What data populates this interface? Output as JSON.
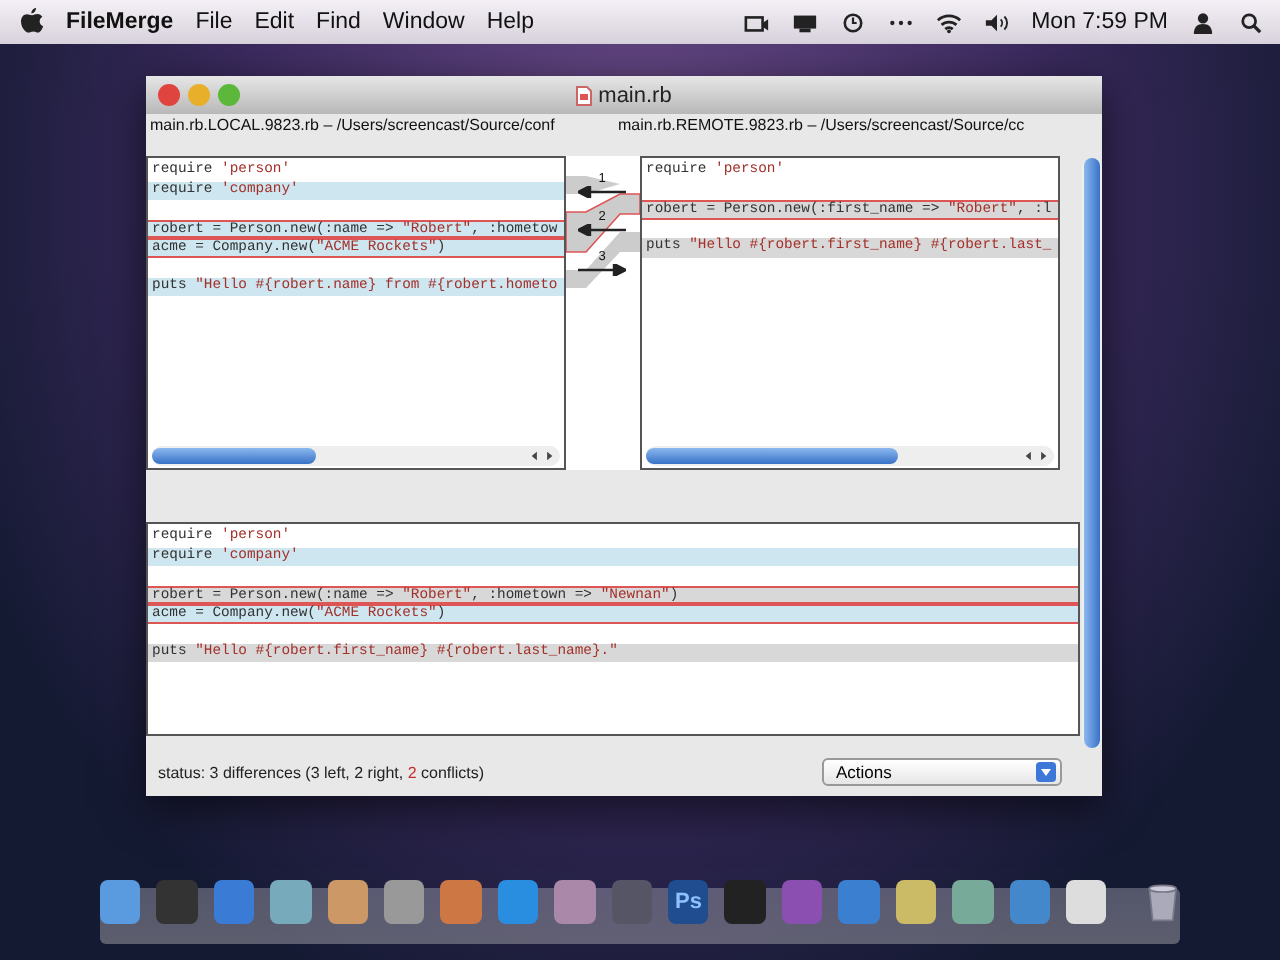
{
  "menu_bar": {
    "app_name": "FileMerge",
    "menus": [
      "File",
      "Edit",
      "Find",
      "Window",
      "Help"
    ],
    "clock": "Mon 7:59 PM"
  },
  "window": {
    "title": "main.rb",
    "left_file": "main.rb.LOCAL.9823.rb – /Users/screencast/Source/conf",
    "right_file": "main.rb.REMOTE.9823.rb – /Users/screencast/Source/cc",
    "left_lines": [
      {
        "kind": "plain",
        "conflict": false,
        "segments": [
          {
            "text": "require ",
            "kind": "code"
          },
          {
            "text": "'person'",
            "kind": "string"
          }
        ]
      },
      {
        "kind": "left",
        "conflict": false,
        "segments": [
          {
            "text": "require ",
            "kind": "code"
          },
          {
            "text": "'company'",
            "kind": "string"
          }
        ]
      },
      {
        "kind": "blank"
      },
      {
        "kind": "left",
        "conflict": true,
        "segments": [
          {
            "text": "robert = Person.new(:name => ",
            "kind": "code"
          },
          {
            "text": "\"Robert\"",
            "kind": "string"
          },
          {
            "text": ", :hometow",
            "kind": "code"
          }
        ]
      },
      {
        "kind": "left",
        "conflict": true,
        "segments": [
          {
            "text": "acme = Company.new(",
            "kind": "code"
          },
          {
            "text": "\"ACME Rockets\"",
            "kind": "string"
          },
          {
            "text": ")",
            "kind": "code"
          }
        ]
      },
      {
        "kind": "blank"
      },
      {
        "kind": "left",
        "conflict": false,
        "segments": [
          {
            "text": "puts ",
            "kind": "code"
          },
          {
            "text": "\"Hello #{robert.name} from #{robert.hometo",
            "kind": "string"
          }
        ]
      }
    ],
    "right_lines": [
      {
        "kind": "plain",
        "conflict": false,
        "segments": [
          {
            "text": "require ",
            "kind": "code"
          },
          {
            "text": "'person'",
            "kind": "string"
          }
        ]
      },
      {
        "kind": "blank"
      },
      {
        "kind": "right",
        "conflict": true,
        "segments": [
          {
            "text": "robert = Person.new(:first_name => ",
            "kind": "code"
          },
          {
            "text": "\"Robert\"",
            "kind": "string"
          },
          {
            "text": ", :l",
            "kind": "code"
          }
        ]
      },
      {
        "kind": "blank"
      },
      {
        "kind": "right",
        "conflict": false,
        "segments": [
          {
            "text": "puts ",
            "kind": "code"
          },
          {
            "text": "\"Hello #{robert.first_name} #{robert.last_",
            "kind": "string"
          }
        ]
      }
    ],
    "differences": [
      {
        "label": "1",
        "kind": "left"
      },
      {
        "label": "2",
        "kind": "left"
      },
      {
        "label": "3",
        "kind": "right"
      }
    ],
    "merged_lines": [
      {
        "kind": "plain",
        "conflict": false,
        "segments": [
          {
            "text": "require ",
            "kind": "code"
          },
          {
            "text": "'person'",
            "kind": "string"
          }
        ]
      },
      {
        "kind": "left",
        "conflict": false,
        "segments": [
          {
            "text": "require ",
            "kind": "code"
          },
          {
            "text": "'company'",
            "kind": "string"
          }
        ]
      },
      {
        "kind": "blank"
      },
      {
        "kind": "right",
        "conflict": true,
        "segments": [
          {
            "text": "robert = Person.new(:name => ",
            "kind": "code"
          },
          {
            "text": "\"Robert\"",
            "kind": "string"
          },
          {
            "text": ", :hometown => ",
            "kind": "code"
          },
          {
            "text": "\"Newnan\"",
            "kind": "string"
          },
          {
            "text": ")",
            "kind": "code"
          }
        ]
      },
      {
        "kind": "left",
        "conflict": true,
        "segments": [
          {
            "text": "acme = Company.new(",
            "kind": "code"
          },
          {
            "text": "\"ACME Rockets\"",
            "kind": "string"
          },
          {
            "text": ")",
            "kind": "code"
          }
        ]
      },
      {
        "kind": "blank"
      },
      {
        "kind": "right",
        "conflict": false,
        "segments": [
          {
            "text": "puts ",
            "kind": "code"
          },
          {
            "text": "\"Hello #{robert.first_name} #{robert.last_name}.\"",
            "kind": "string"
          }
        ]
      }
    ],
    "status": [
      {
        "text": "status: 3 differences  (3 left,  2 right, ",
        "kind": "plain"
      },
      {
        "text": "2",
        "kind": "alert"
      },
      {
        "text": " conflicts)",
        "kind": "plain"
      }
    ],
    "actions": "Actions"
  },
  "dock": {
    "photoshop_label": "Ps"
  }
}
